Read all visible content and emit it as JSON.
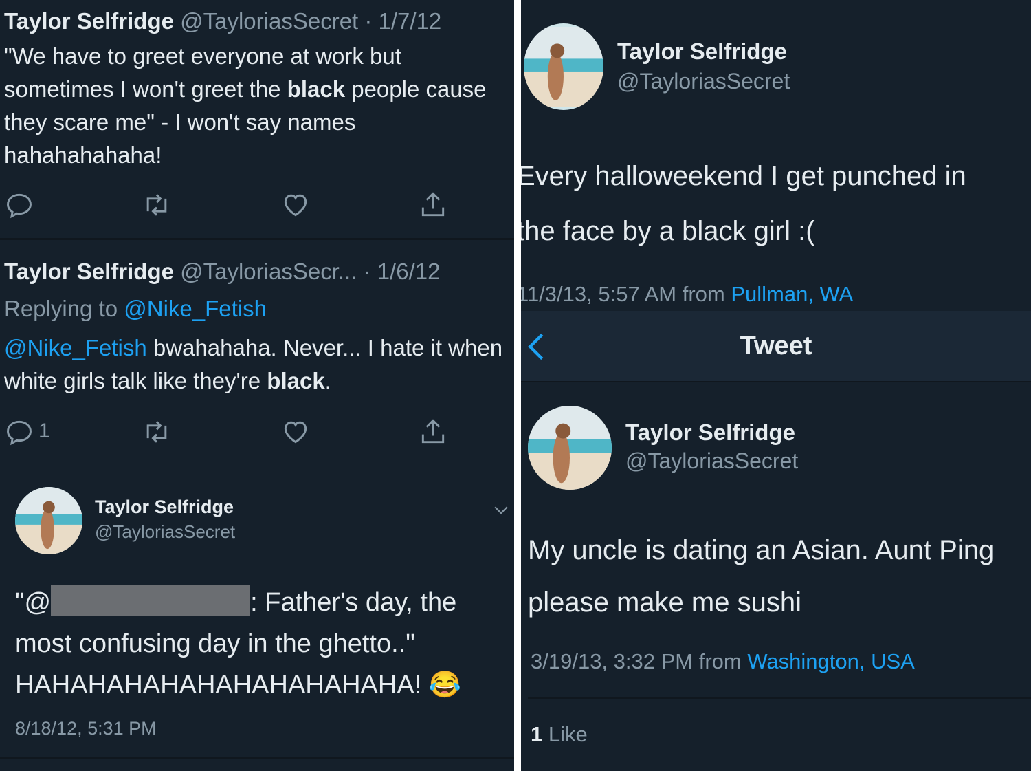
{
  "left": {
    "tweet1": {
      "name": "Taylor Selfridge",
      "meta": "@TayloriasSecret · 1/7/12",
      "text_a": "\"We have to greet everyone at work but sometimes I won't greet the ",
      "text_bold": "black",
      "text_b": " people cause they scare me\" - I won't say names hahahahahaha!"
    },
    "tweet2": {
      "name": "Taylor Selfridge",
      "meta": "@TayloriasSecr... · 1/6/12",
      "replying_label": "Replying to ",
      "replying_handle": "@Nike_Fetish",
      "mention": "@Nike_Fetish",
      "text_a": " bwahahaha. Never... I hate it when white girls talk like they're ",
      "text_bold": "black",
      "text_b": ".",
      "reply_count": "1"
    },
    "tweet3": {
      "name": "Taylor Selfridge",
      "handle": "@TayloriasSecret",
      "quote_open": "\"@",
      "text_after_redaction": ": Father's day, the most confusing day in the ghetto..\" HAHAHAHAHAHAHAHAHAHAHA!",
      "emoji": "😂",
      "timestamp": "8/18/12, 5:31 PM"
    }
  },
  "right": {
    "tweet1": {
      "name": "Taylor Selfridge",
      "handle": "@TayloriasSecret",
      "line1": "Every halloweekend I get punched in",
      "line2": "the face by a black girl :(",
      "time": "11/3/13, 5:57 AM from ",
      "location": "Pullman, WA"
    },
    "nav": {
      "title": "Tweet",
      "back_icon": "chevron-left-icon"
    },
    "tweet2": {
      "name": "Taylor Selfridge",
      "handle": "@TayloriasSecret",
      "line1": "My uncle is dating an Asian. Aunt Ping",
      "line2": "please make me sushi",
      "time": "3/19/13, 3:32 PM from ",
      "location": "Washington, USA",
      "likes_count": "1",
      "likes_label": " Like"
    }
  },
  "icons": [
    "reply-icon",
    "retweet-icon",
    "like-icon",
    "share-icon",
    "chevron-down-icon",
    "chevron-left-icon"
  ],
  "colors": {
    "background": "#15202b",
    "link": "#1da1f2",
    "muted": "#8899a6",
    "text": "#e6ecf0"
  }
}
